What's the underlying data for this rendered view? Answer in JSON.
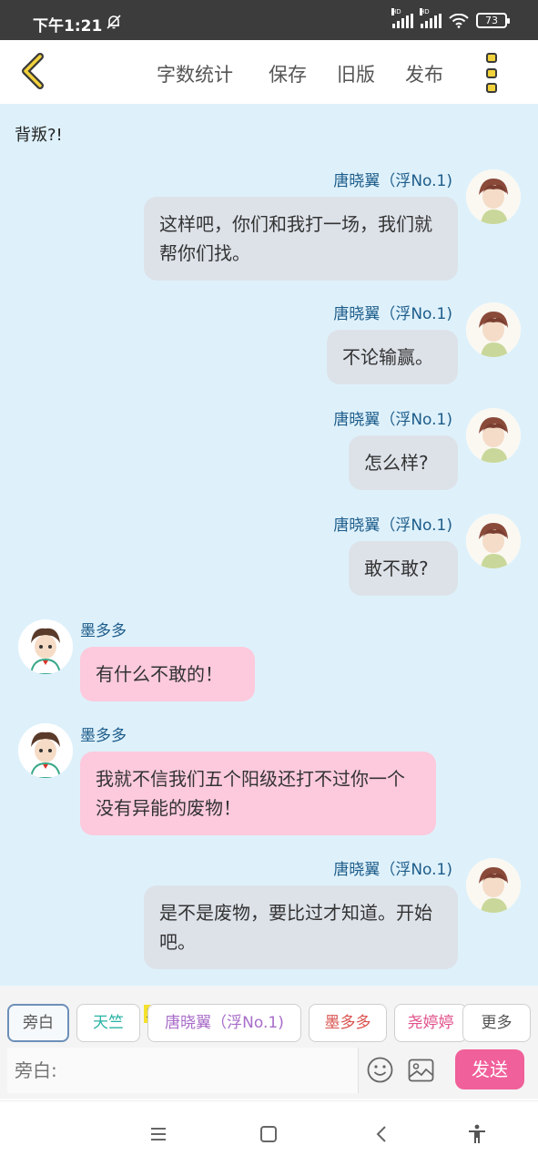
{
  "status_bar": {
    "time": "下午1:21",
    "signal_1_label": "HD",
    "signal_2_label": "HD",
    "battery": "73"
  },
  "toolbar": {
    "word_count": "字数统计",
    "save": "保存",
    "old_version": "旧版",
    "publish": "发布"
  },
  "chat": {
    "narration": "背叛?!",
    "messages": [
      {
        "speaker": "唐晓翼（浮No.1)",
        "text": "这样吧，你们和我打一场，我们就帮你们找。"
      },
      {
        "speaker": "唐晓翼（浮No.1)",
        "text": "不论输赢。"
      },
      {
        "speaker": "唐晓翼（浮No.1)",
        "text": "怎么样?"
      },
      {
        "speaker": "唐晓翼（浮No.1)",
        "text": "敢不敢?"
      },
      {
        "speaker": "墨多多",
        "text": "有什么不敢的！"
      },
      {
        "speaker": "墨多多",
        "text": "我就不信我们五个阳级还打不过你一个没有异能的废物！"
      },
      {
        "speaker": "唐晓翼（浮No.1)",
        "text": "是不是废物，要比过才知道。开始吧。"
      }
    ]
  },
  "roles": {
    "narrator": "旁白",
    "tianzhu": "天竺",
    "main_tag": "主",
    "tang": "唐晓翼（浮No.1)",
    "mo": "墨多多",
    "yao": "尧婷婷",
    "more": "更多"
  },
  "roles_colors": {
    "tianzhu": "#2bb3a6",
    "tang": "#a86cc9",
    "mo": "#d9534f",
    "yao": "#e0508a"
  },
  "input": {
    "placeholder": "旁白:"
  },
  "send_label": "发送"
}
